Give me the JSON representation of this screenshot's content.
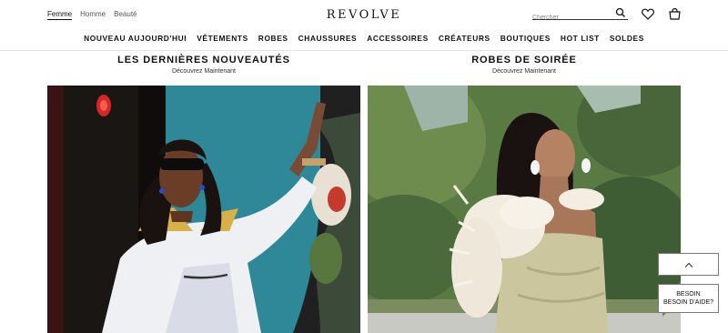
{
  "header": {
    "gender_tabs": [
      "Femme",
      "Homme",
      "Beauté"
    ],
    "logo": "REVOLVE",
    "search_placeholder": "Chercher",
    "icons": [
      "search-icon",
      "heart-icon",
      "bag-icon"
    ]
  },
  "nav": [
    "NOUVEAU AUJOURD'HUI",
    "VÊTEMENTS",
    "ROBES",
    "CHAUSSURES",
    "ACCESSOIRES",
    "CRÉATEURS",
    "BOUTIQUES",
    "HOT LIST",
    "SOLDES"
  ],
  "sections": [
    {
      "title": "LES DERNIÈRES NOUVEAUTÉS",
      "subtitle": "Découvrez Maintenant"
    },
    {
      "title": "ROBES DE SOIRÉE",
      "subtitle": "Découvrez Maintenant"
    }
  ],
  "help": {
    "line1": "BESOIN",
    "line2": "BESOIN D'AIDE?"
  },
  "colors": {
    "text": "#111111",
    "wall_teal": "#2d8a9a",
    "dress_sage": "#c9c49a",
    "foliage": "#4d6b35"
  }
}
